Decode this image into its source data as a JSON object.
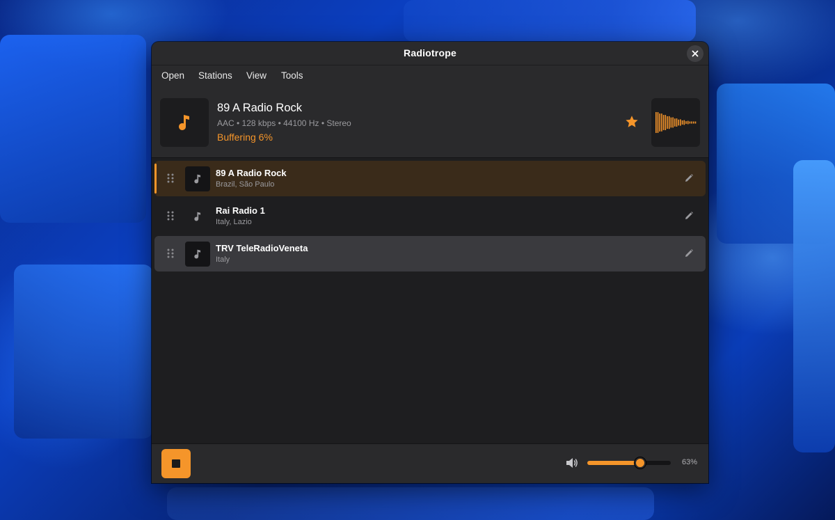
{
  "window": {
    "title": "Radiotrope"
  },
  "menu": [
    "Open",
    "Stations",
    "View",
    "Tools"
  ],
  "now_playing": {
    "station": "89 A Radio Rock",
    "codec_info": "AAC • 128 kbps • 44100 Hz • Stereo",
    "status": "Buffering 6%",
    "favorite": true
  },
  "stations": [
    {
      "name": "89 A Radio Rock",
      "location": "Brazil, São Paulo",
      "state": "active"
    },
    {
      "name": "Rai Radio 1",
      "location": "Italy, Lazio",
      "state": "normal"
    },
    {
      "name": "TRV TeleRadioVeneta",
      "location": "Italy",
      "state": "hover"
    }
  ],
  "volume": {
    "value": 63,
    "label": "63%"
  },
  "colors": {
    "accent": "#f5952a",
    "window_bg": "#1e1e20",
    "panel_bg": "#2a2a2c"
  },
  "icons": {
    "close": "close-icon",
    "art": "music-note-icon",
    "favorite": "star-icon",
    "drag": "drag-handle-icon",
    "edit": "pencil-icon",
    "stop": "stop-icon",
    "volume": "speaker-icon"
  }
}
